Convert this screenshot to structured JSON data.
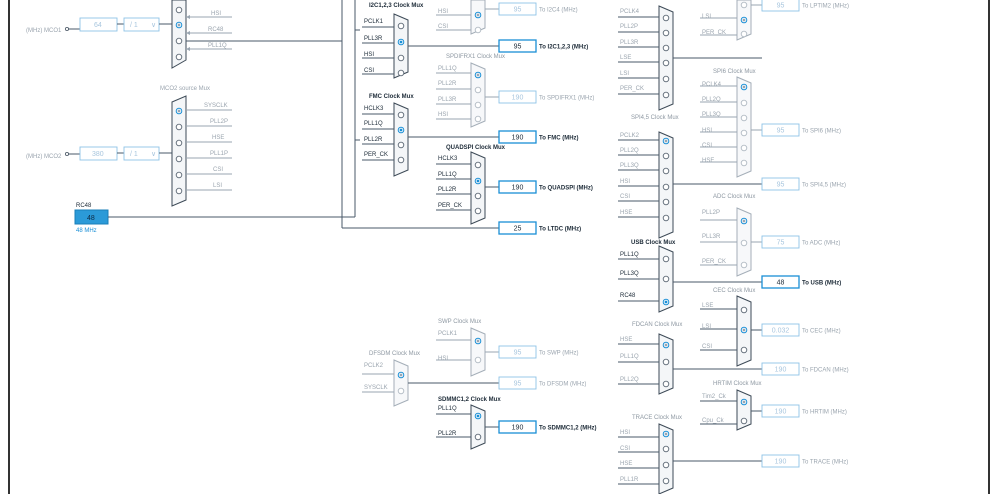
{
  "colors": {
    "accent": "#1a8fd6",
    "wire": "#4a5a6a",
    "dim": "#9aa4ae",
    "rc48": "#2b9ad8"
  },
  "mco": {
    "mco1_label": "(MHz) MCO1",
    "mco1_value": "64",
    "mco1_div": "/ 1",
    "mco1_inputs": [
      "HSI",
      "RC48",
      "PLL1Q"
    ],
    "mco2_label": "(MHz) MCO2",
    "mco2_value": "380",
    "mco2_div": "/ 1",
    "mco2_title": "MCO2 source Mux",
    "mco2_inputs": [
      "SYSCLK",
      "PLL2P",
      "HSE",
      "PLL1P",
      "CSI",
      "LSI"
    ]
  },
  "rc48": {
    "label": "RC48",
    "value": "48",
    "unit": "48 MHz"
  },
  "left_muxes": [
    {
      "title": "I2C1,2,3 Clock Mux",
      "inputs": [
        "PCLK1",
        "PLL3R",
        "HSI",
        "CSI"
      ]
    },
    {
      "title": "FMC Clock Mux",
      "inputs": [
        "HCLK3",
        "PLL1Q",
        "PLL2R",
        "PER_CK"
      ]
    },
    {
      "title": "DFSDM Clock Mux",
      "inputs": [
        "PCLK2",
        "SYSCLK"
      ]
    }
  ],
  "mid_muxes": [
    {
      "title": "",
      "inputs": [
        "HSI",
        "CSI"
      ],
      "value": "95",
      "dest": "To I2C4 (MHz)"
    },
    {
      "title": "",
      "inputs": [],
      "value": "95",
      "dest": "To I2C1,2,3 (MHz)"
    },
    {
      "title": "SPDIFRX1 Clock Mux",
      "inputs": [
        "PLL1Q",
        "PLL2R",
        "PLL3R",
        "HSI"
      ],
      "value": "190",
      "dest": "To SPDIFRX1 (MHz)"
    },
    {
      "title": "",
      "inputs": [],
      "value": "190",
      "dest": "To FMC (MHz)"
    },
    {
      "title": "QUADSPI Clock Mux",
      "inputs": [
        "HCLK3",
        "PLL1Q",
        "PLL2R",
        "PER_CK"
      ],
      "value": "190",
      "dest": "To QUADSPI (MHz)"
    },
    {
      "title": "",
      "inputs": [],
      "value": "25",
      "dest": "To LTDC (MHz)"
    },
    {
      "title": "SWP Clock Mux",
      "inputs": [
        "PCLK1",
        "HSI"
      ],
      "value": "95",
      "dest": "To SWP (MHz)"
    },
    {
      "title": "",
      "inputs": [],
      "value": "95",
      "dest": "To DFSDM (MHz)"
    },
    {
      "title": "SDMMC1,2 Clock Mux",
      "inputs": [
        "PLL1Q",
        "PLL2R"
      ],
      "value": "190",
      "dest": "To SDMMC1,2 (MHz)"
    }
  ],
  "right_left_muxes": [
    {
      "title": "",
      "inputs": [
        "PCLK4",
        "PLL2P",
        "PLL3R",
        "LSE",
        "LSI",
        "PER_CK"
      ]
    },
    {
      "title": "SPI4,5 Clock Mux",
      "inputs": [
        "PCLK2",
        "PLL2Q",
        "PLL3Q",
        "HSI",
        "CSI",
        "HSE"
      ]
    },
    {
      "title": "USB Clock Mux",
      "inputs": [
        "PLL1Q",
        "PLL3Q",
        "RC48"
      ]
    },
    {
      "title": "FDCAN Clock Mux",
      "inputs": [
        "HSE",
        "PLL1Q",
        "PLL2Q"
      ]
    },
    {
      "title": "TRACE Clock Mux",
      "inputs": [
        "HSI",
        "CSI",
        "HSE",
        "PLL1R"
      ]
    }
  ],
  "right_muxes": [
    {
      "title": "",
      "inputs": [
        "LSI",
        "PER_CK"
      ],
      "value": "95",
      "dest": "To LPTIM2 (MHz)"
    },
    {
      "title": "SPI6 Clock Mux",
      "inputs": [
        "PCLK4",
        "PLL2Q",
        "PLL3Q",
        "HSI",
        "CSI",
        "HSE"
      ],
      "value": "95",
      "dest": "To SPI6 (MHz)"
    },
    {
      "title": "",
      "inputs": [],
      "value": "95",
      "dest": "To SPI4,5 (MHz)"
    },
    {
      "title": "ADC Clock Mux",
      "inputs": [
        "PLL2P",
        "PLL3R",
        "PER_CK"
      ],
      "value": "75",
      "dest": "To ADC (MHz)"
    },
    {
      "title": "",
      "inputs": [],
      "value": "48",
      "dest": "To USB (MHz)"
    },
    {
      "title": "CEC Clock Mux",
      "inputs": [
        "LSE",
        "LSI",
        "CSI"
      ],
      "value": "0.032",
      "dest": "To CEC (MHz)"
    },
    {
      "title": "",
      "inputs": [],
      "value": "190",
      "dest": "To FDCAN (MHz)"
    },
    {
      "title": "HRTIM Clock Mux",
      "inputs": [
        "Tim2_Ck",
        "Cpu_Ck"
      ],
      "value": "190",
      "dest": "To HRTIM (MHz)"
    },
    {
      "title": "",
      "inputs": [],
      "value": "190",
      "dest": "To TRACE (MHz)"
    }
  ]
}
